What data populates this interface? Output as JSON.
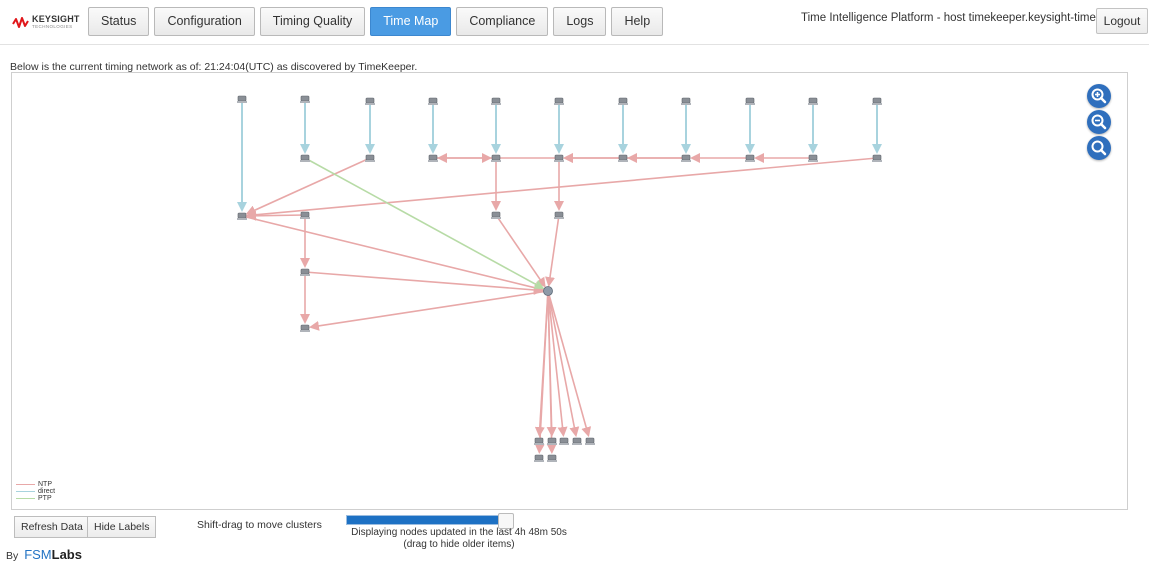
{
  "brand": {
    "logo_text": "KEYSIGHT",
    "logo_subtext": "TECHNOLOGIES",
    "logo_color": "#e0161a"
  },
  "nav": {
    "tabs": [
      {
        "label": "Status",
        "active": false
      },
      {
        "label": "Configuration",
        "active": false
      },
      {
        "label": "Timing Quality",
        "active": false
      },
      {
        "label": "Time Map",
        "active": true
      },
      {
        "label": "Compliance",
        "active": false
      },
      {
        "label": "Logs",
        "active": false
      },
      {
        "label": "Help",
        "active": false
      }
    ],
    "active_color": "#4a9be3"
  },
  "header": {
    "host_text": "Time Intelligence Platform - host timekeeper.keysight-time.com",
    "logout_label": "Logout"
  },
  "intro_text": "Below is the current timing network as of: 21:24:04(UTC) as discovered by TimeKeeper.",
  "map": {
    "zoom_controls": [
      {
        "icon": "zoom-in-icon"
      },
      {
        "icon": "zoom-out-icon"
      },
      {
        "icon": "zoom-reset-icon"
      }
    ],
    "legend": [
      {
        "label": "NTP",
        "color": "#e8a8a8"
      },
      {
        "label": "direct",
        "color": "#a8d3de"
      },
      {
        "label": "PTP",
        "color": "#b7dba6"
      }
    ],
    "node_icon": "server-icon",
    "hub_icon": "timekeeper-hub-icon"
  },
  "controls": {
    "refresh_label": "Refresh Data",
    "hide_labels_label": "Hide Labels",
    "hint": "Shift-drag to move clusters",
    "slider_fraction": 0.925,
    "slider_caption_line1": "Displaying nodes updated in the last 4h 48m 50s",
    "slider_caption_line2": "(drag to hide older items)"
  },
  "footer": {
    "by_label": "By",
    "brand_prefix": "FSM",
    "brand_suffix": "Labs"
  }
}
